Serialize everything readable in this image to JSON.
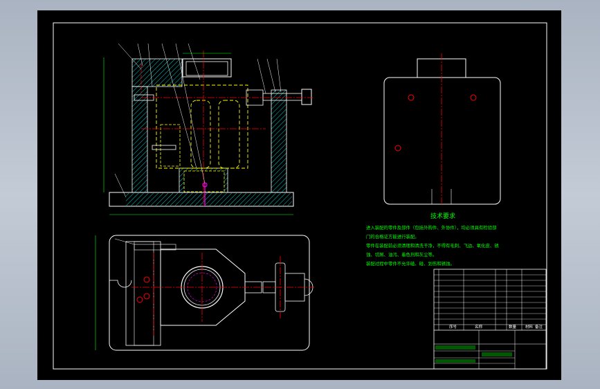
{
  "drawing": {
    "tech_title": "技术要求",
    "tech_lines": [
      "进入装配的零件及部件（包括外购件、外协件），均必须具有检验部",
      "门的合格证方能进行装配。",
      "零件在装配前必须清理和清洗干净，不得有毛刺、飞边、氧化皮、锈",
      "蚀、切屑、油污、着色剂和灰尘等。",
      "装配过程中零件不允许磕、碰、划伤和锈蚀。"
    ],
    "title_block": {
      "header": {
        "no": "序号",
        "name": "名称",
        "qty": "数量",
        "material": "材料",
        "remark": "备注"
      }
    }
  },
  "colors": {
    "background": "#000000",
    "frame": "#ffffff",
    "section": "#00ffff",
    "hidden": "#ffff00",
    "center": "#ff0000",
    "dimension": "#00ff00",
    "outline": "#ffffff"
  }
}
